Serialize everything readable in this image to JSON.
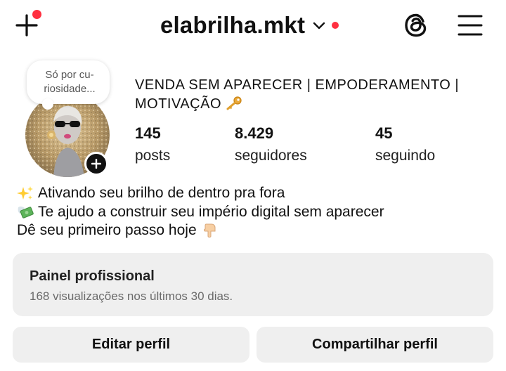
{
  "header": {
    "username": "elabrilha.mkt",
    "new_post_icon": "plus-icon",
    "switch_account_icon": "chevron-down-icon",
    "threads_icon": "threads-icon",
    "menu_icon": "hamburger-menu-icon",
    "notification_color": "#ff3040"
  },
  "profile": {
    "note": "Só por cu-riosidade...",
    "display_name": "VENDA SEM APARECER | EMPODERAMENTO | MOTIVAÇÃO",
    "display_name_emoji": "key-emoji",
    "stats": {
      "posts_count": "145",
      "posts_label": "posts",
      "followers_count": "8.429",
      "followers_label": "seguidores",
      "following_count": "45",
      "following_label": "seguindo"
    }
  },
  "bio": {
    "lines": [
      {
        "emoji": "sparkles-emoji",
        "text": "Ativando seu brilho de dentro pra fora"
      },
      {
        "emoji": "money-with-wings-emoji",
        "text": "Te ajudo a construir seu império digital sem aparecer"
      },
      {
        "emoji": "point-down-emoji",
        "text": "Dê seu primeiro passo hoje"
      }
    ]
  },
  "professional_panel": {
    "title": "Painel profissional",
    "subtitle": "168 visualizações nos últimos 30 dias."
  },
  "actions": {
    "edit_label": "Editar perfil",
    "share_label": "Compartilhar perfil"
  }
}
